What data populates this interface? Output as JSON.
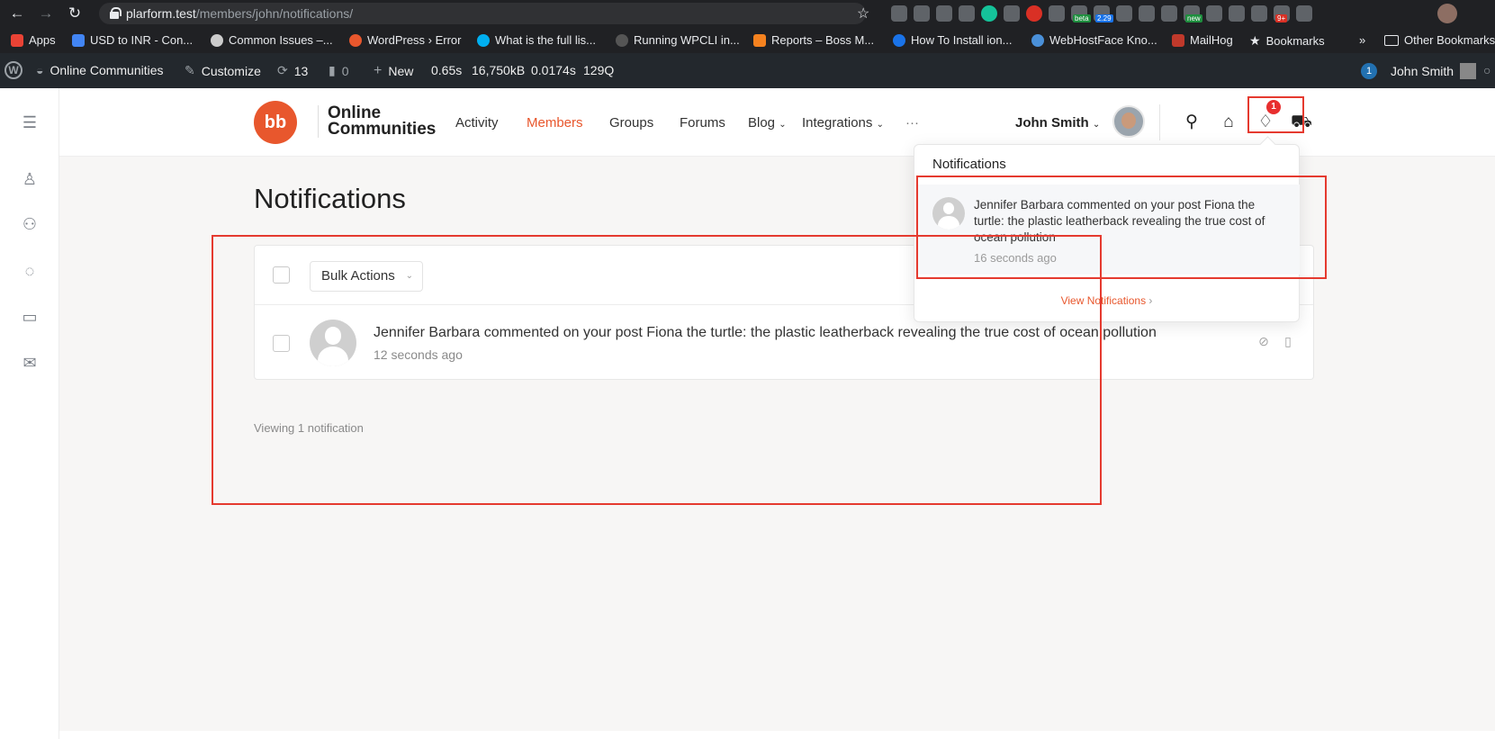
{
  "browser": {
    "url_host": "plarform.test",
    "url_path": "/members/john/notifications/",
    "extension_badges": {
      "beta": "beta",
      "count": "2.29",
      "new": "new",
      "more": "9+"
    },
    "bookmarks": [
      {
        "label": "Apps"
      },
      {
        "label": "USD to INR - Con..."
      },
      {
        "label": "Common Issues –..."
      },
      {
        "label": "WordPress › Error"
      },
      {
        "label": "What is the full lis..."
      },
      {
        "label": "Running WPCLI in..."
      },
      {
        "label": "Reports – Boss M..."
      },
      {
        "label": "How To Install ion..."
      },
      {
        "label": "WebHostFace Kno..."
      },
      {
        "label": "MailHog"
      },
      {
        "label": "Bookmarks"
      },
      {
        "label": "»"
      },
      {
        "label": "Other Bookmarks"
      }
    ]
  },
  "wp_admin_bar": {
    "site_name": "Online Communities",
    "customize": "Customize",
    "updates_count": "13",
    "comments_count": "0",
    "new_label": "New",
    "perf_time": "0.65s",
    "perf_memory": "16,750kB",
    "perf_query_time": "0.0174s",
    "perf_queries": "129Q",
    "notif_count": "1",
    "user_name": "John Smith"
  },
  "header": {
    "logo_mark": "bb",
    "logo_line1": "Online",
    "logo_line2": "Communities",
    "nav": [
      {
        "label": "Activity"
      },
      {
        "label": "Members"
      },
      {
        "label": "Groups"
      },
      {
        "label": "Forums"
      },
      {
        "label": "Blog"
      },
      {
        "label": "Integrations"
      },
      {
        "label": "···"
      }
    ],
    "user_name": "John Smith",
    "notification_badge": "1"
  },
  "main": {
    "page_title": "Notifications",
    "bulk_actions_label": "Bulk Actions",
    "notification": {
      "text": "Jennifer Barbara commented on your post Fiona the turtle: the plastic leatherback revealing the true cost of ocean pollution",
      "time": "12 seconds ago"
    },
    "viewing_label": "Viewing 1 notification"
  },
  "dropdown": {
    "title": "Notifications",
    "item_text": "Jennifer Barbara commented on your post Fiona the turtle: the plastic leatherback revealing the true cost of ocean pollution",
    "item_time": "16 seconds ago",
    "view_label": "View Notifications"
  },
  "colors": {
    "accent": "#e8572d",
    "badge": "#e82f2f",
    "annotation": "#e53a2f",
    "wp_bar": "#23282d",
    "chrome": "#202124"
  }
}
